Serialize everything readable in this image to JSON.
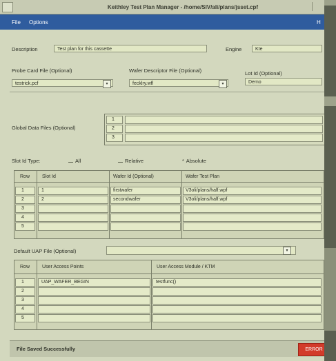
{
  "window": {
    "title": "Keithley Test Plan Manager - /home/SIV/ali/plans/jsset.cpf"
  },
  "menu": {
    "file": "File",
    "options": "Options",
    "help": "H"
  },
  "form": {
    "description_label": "Description",
    "description_value": "Test plan for this cassette",
    "engine_label": "Engine",
    "engine_value": "Kte",
    "probe_card_label": "Probe Card File (Optional)",
    "probe_card_value": "testrick.pcf",
    "wafer_descriptor_label": "Wafer Descriptor File (Optional)",
    "wafer_descriptor_value": "fecklry.wfl",
    "lot_id_label": "Lot Id (Optional)",
    "lot_id_value": "Demo",
    "global_data_label": "Global Data Files (Optional)",
    "global_data_rows": [
      "1",
      "2",
      "3"
    ]
  },
  "slot_id_type": {
    "label": "Slot Id Type:",
    "options": [
      "All",
      "Relative",
      "Absolute"
    ],
    "selected": "Absolute"
  },
  "slot_table": {
    "headers": [
      "Row",
      "Slot Id",
      "Wafer Id (Optional)",
      "Wafer Test Plan"
    ],
    "rows": [
      {
        "row": "1",
        "slot": "1",
        "wafer": "firstwafer",
        "plan": "V3oli/plans/half.wpf"
      },
      {
        "row": "2",
        "slot": "2",
        "wafer": "secondwafer",
        "plan": "V3oli/plans/half.wpf"
      },
      {
        "row": "3",
        "slot": "",
        "wafer": "",
        "plan": ""
      },
      {
        "row": "4",
        "slot": "",
        "wafer": "",
        "plan": ""
      },
      {
        "row": "5",
        "slot": "",
        "wafer": "",
        "plan": ""
      }
    ]
  },
  "uap": {
    "label": "Default UAP File (Optional)",
    "value": "",
    "headers": [
      "Row",
      "User Access Points",
      "User Access Module / KTM"
    ],
    "rows": [
      {
        "row": "1",
        "point": "UAP_WAFER_BEGIN",
        "module": "testfunc()"
      },
      {
        "row": "2",
        "point": "",
        "module": ""
      },
      {
        "row": "3",
        "point": "",
        "module": ""
      },
      {
        "row": "4",
        "point": "",
        "module": ""
      },
      {
        "row": "5",
        "point": "",
        "module": ""
      }
    ]
  },
  "status": {
    "message": "File Saved Successfully",
    "badge": "ERROR"
  }
}
